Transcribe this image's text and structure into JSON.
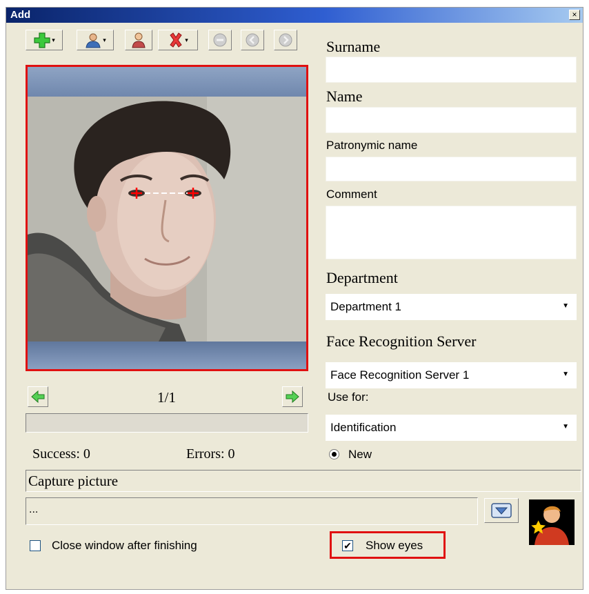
{
  "window": {
    "title": "Add",
    "close_glyph": "×"
  },
  "toolbar": {
    "items": [
      {
        "icon": "add-icon",
        "has_dropdown": true
      },
      {
        "icon": "user-menu-icon",
        "has_dropdown": true
      },
      {
        "icon": "person-icon",
        "has_dropdown": false
      },
      {
        "icon": "delete-icon",
        "has_dropdown": true
      },
      {
        "icon": "minus-circle-icon",
        "has_dropdown": false
      },
      {
        "icon": "back-circle-icon",
        "has_dropdown": false
      },
      {
        "icon": "forward-circle-icon",
        "has_dropdown": false
      }
    ],
    "caret": "▾"
  },
  "photo": {
    "pager": "1/1"
  },
  "progress": {
    "fraction": 0
  },
  "stats": {
    "success": "Success: 0",
    "errors": "Errors: 0"
  },
  "form": {
    "surname_label": "Surname",
    "surname_value": "",
    "name_label": "Name",
    "name_value": "",
    "patronymic_label": "Patronymic name",
    "patronymic_value": "",
    "comment_label": "Comment",
    "comment_value": "",
    "department_label": "Department",
    "department_value": "Department 1",
    "server_label": "Face Recognition Server",
    "server_value": "Face Recognition Server 1",
    "use_for_label": "Use for:",
    "use_for_value": "Identification",
    "new_radio_label": "New",
    "combo_arrow": "▼"
  },
  "capture": {
    "label": "Capture picture"
  },
  "path": {
    "value": "..."
  },
  "options": {
    "close_after_label": "Close window after finishing",
    "close_after_checked": false,
    "show_eyes_label": "Show eyes",
    "show_eyes_checked": true,
    "check_glyph": "✔"
  },
  "colors": {
    "highlight": "#e01010",
    "title_bar": "#0a246a",
    "dialog_bg": "#ece9d8"
  }
}
